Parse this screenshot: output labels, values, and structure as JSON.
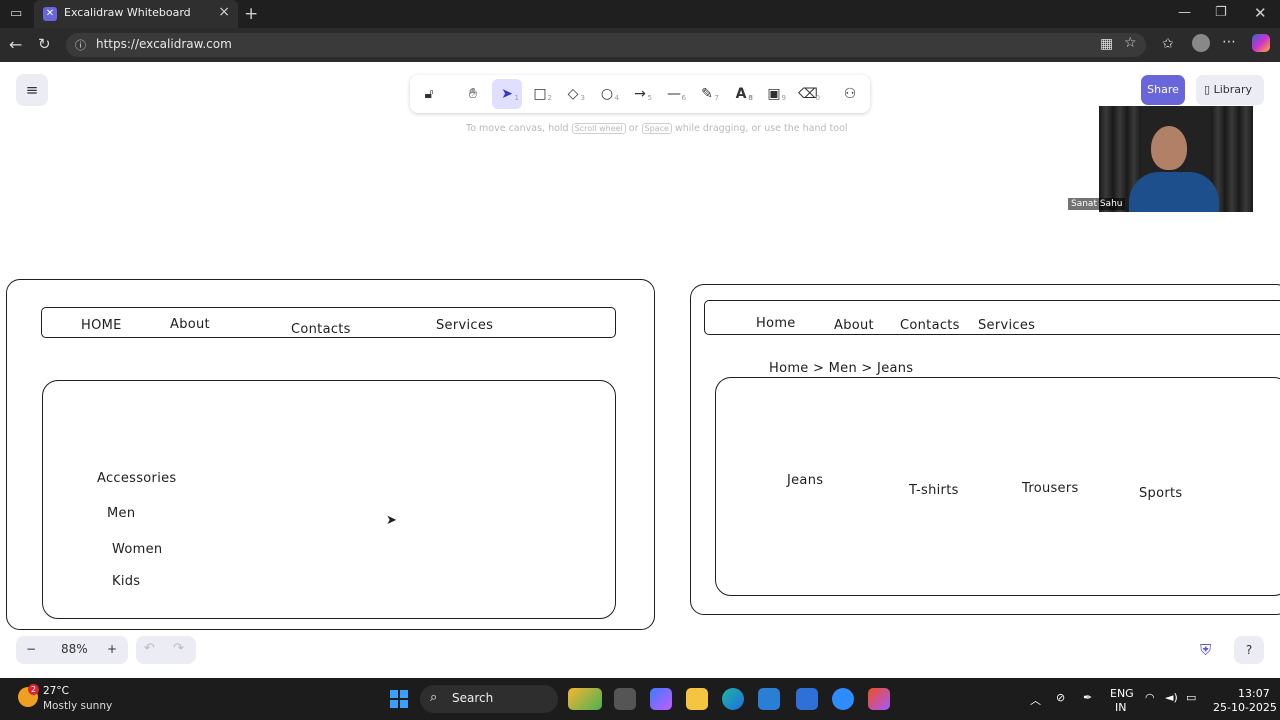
{
  "browser": {
    "tab_title": "Excalidraw Whiteboard",
    "url": "https://excalidraw.com"
  },
  "toolbar": {
    "hint_prefix": "To move canvas, hold",
    "hint_key1": "Scroll wheel",
    "hint_or": "or",
    "hint_key2": "Space",
    "hint_suffix": "while dragging, or use the hand tool",
    "tools": [
      {
        "icon": "lock-icon",
        "num": ""
      },
      {
        "icon": "hand-icon",
        "num": ""
      },
      {
        "icon": "pointer-icon",
        "num": "1"
      },
      {
        "icon": "rectangle-icon",
        "num": "2"
      },
      {
        "icon": "diamond-icon",
        "num": "3"
      },
      {
        "icon": "ellipse-icon",
        "num": "4"
      },
      {
        "icon": "arrow-icon",
        "num": "5"
      },
      {
        "icon": "line-icon",
        "num": "6"
      },
      {
        "icon": "pencil-icon",
        "num": "7"
      },
      {
        "icon": "text-icon",
        "num": "8"
      },
      {
        "icon": "image-icon",
        "num": "9"
      },
      {
        "icon": "eraser-icon",
        "num": "0"
      },
      {
        "icon": "extra-tools-icon",
        "num": ""
      }
    ]
  },
  "header": {
    "share_label": "Share",
    "library_label": "Library"
  },
  "video": {
    "participant_name": "Sanat Sahu"
  },
  "wireframe_left": {
    "nav": [
      "HOME",
      "About",
      "Contacts",
      "Services"
    ],
    "categories": [
      "Accessories",
      "Men",
      "Women",
      "Kids"
    ]
  },
  "wireframe_right": {
    "nav": [
      "Home",
      "About",
      "Contacts",
      "Services"
    ],
    "breadcrumb": "Home > Men > Jeans",
    "products": [
      "Jeans",
      "T-shirts",
      "Trousers",
      "Sports"
    ]
  },
  "footer": {
    "zoom": "88%",
    "zoom_out": "−",
    "zoom_in": "+"
  },
  "taskbar": {
    "temperature": "27°C",
    "condition": "Mostly sunny",
    "weather_badge": "2",
    "search_label": "Search",
    "lang_line1": "ENG",
    "lang_line2": "IN",
    "time": "13:07",
    "date": "25-10-2025"
  }
}
